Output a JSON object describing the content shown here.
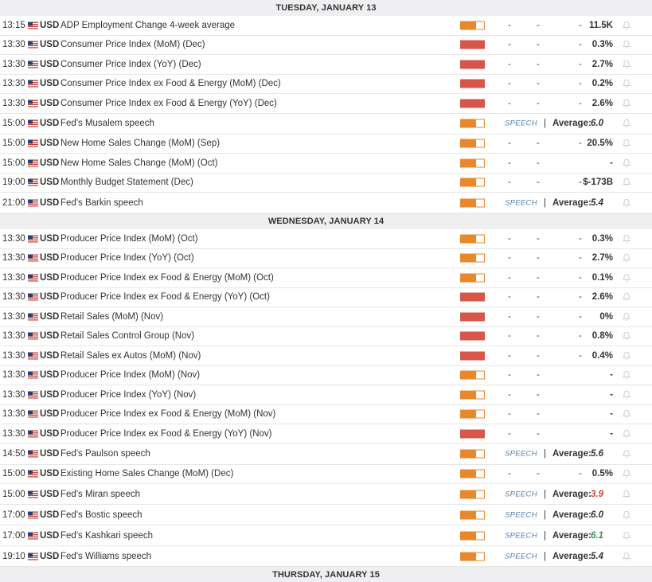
{
  "colors": {
    "medium": "#e8882a",
    "high": "#d6564a",
    "speech": "#5b7ea6",
    "negative": "#c0483a",
    "positive": "#3f8a5c"
  },
  "icons": {
    "flag": "us-flag-icon",
    "alert": "bell-icon"
  },
  "days": [
    {
      "label": "TUESDAY, JANUARY 13",
      "events": [
        {
          "time": "13:15",
          "ccy": "USD",
          "name": "ADP Employment Change 4-week average",
          "impact": "medium",
          "type": "data",
          "c1": "-",
          "c2": "-",
          "c3": "-",
          "actual": "11.5K"
        },
        {
          "time": "13:30",
          "ccy": "USD",
          "name": "Consumer Price Index (MoM) (Dec)",
          "impact": "high",
          "type": "data",
          "c1": "-",
          "c2": "-",
          "c3": "-",
          "actual": "0.3%"
        },
        {
          "time": "13:30",
          "ccy": "USD",
          "name": "Consumer Price Index (YoY) (Dec)",
          "impact": "high",
          "type": "data",
          "c1": "-",
          "c2": "-",
          "c3": "-",
          "actual": "2.7%"
        },
        {
          "time": "13:30",
          "ccy": "USD",
          "name": "Consumer Price Index ex Food & Energy (MoM) (Dec)",
          "impact": "high",
          "type": "data",
          "c1": "-",
          "c2": "-",
          "c3": "-",
          "actual": "0.2%"
        },
        {
          "time": "13:30",
          "ccy": "USD",
          "name": "Consumer Price Index ex Food & Energy (YoY) (Dec)",
          "impact": "high",
          "type": "data",
          "c1": "-",
          "c2": "-",
          "c3": "-",
          "actual": "2.6%"
        },
        {
          "time": "15:00",
          "ccy": "USD",
          "name": "Fed's Musalem speech",
          "impact": "medium",
          "type": "speech",
          "speech": "SPEECH",
          "sep": "|",
          "avg_label": "Average:",
          "avg": "6.0",
          "tone": ""
        },
        {
          "time": "15:00",
          "ccy": "USD",
          "name": "New Home Sales Change (MoM) (Sep)",
          "impact": "medium",
          "type": "data",
          "c1": "-",
          "c2": "-",
          "c3": "-",
          "actual": "20.5%"
        },
        {
          "time": "15:00",
          "ccy": "USD",
          "name": "New Home Sales Change (MoM) (Oct)",
          "impact": "medium",
          "type": "data",
          "c1": "-",
          "c2": "-",
          "c3": "-",
          "actual": "-"
        },
        {
          "time": "19:00",
          "ccy": "USD",
          "name": "Monthly Budget Statement (Dec)",
          "impact": "medium",
          "type": "data",
          "c1": "-",
          "c2": "-",
          "c3": "-",
          "actual": "$-173B"
        },
        {
          "time": "21:00",
          "ccy": "USD",
          "name": "Fed's Barkin speech",
          "impact": "medium",
          "type": "speech",
          "speech": "SPEECH",
          "sep": "|",
          "avg_label": "Average:",
          "avg": "5.4",
          "tone": ""
        }
      ]
    },
    {
      "label": "WEDNESDAY, JANUARY 14",
      "events": [
        {
          "time": "13:30",
          "ccy": "USD",
          "name": "Producer Price Index (MoM) (Oct)",
          "impact": "medium",
          "type": "data",
          "c1": "-",
          "c2": "-",
          "c3": "-",
          "actual": "0.3%"
        },
        {
          "time": "13:30",
          "ccy": "USD",
          "name": "Producer Price Index (YoY) (Oct)",
          "impact": "medium",
          "type": "data",
          "c1": "-",
          "c2": "-",
          "c3": "-",
          "actual": "2.7%"
        },
        {
          "time": "13:30",
          "ccy": "USD",
          "name": "Producer Price Index ex Food & Energy (MoM) (Oct)",
          "impact": "medium",
          "type": "data",
          "c1": "-",
          "c2": "-",
          "c3": "-",
          "actual": "0.1%"
        },
        {
          "time": "13:30",
          "ccy": "USD",
          "name": "Producer Price Index ex Food & Energy (YoY) (Oct)",
          "impact": "high",
          "type": "data",
          "c1": "-",
          "c2": "-",
          "c3": "-",
          "actual": "2.6%"
        },
        {
          "time": "13:30",
          "ccy": "USD",
          "name": "Retail Sales (MoM) (Nov)",
          "impact": "high",
          "type": "data",
          "c1": "-",
          "c2": "-",
          "c3": "-",
          "actual": "0%"
        },
        {
          "time": "13:30",
          "ccy": "USD",
          "name": "Retail Sales Control Group (Nov)",
          "impact": "high",
          "type": "data",
          "c1": "-",
          "c2": "-",
          "c3": "-",
          "actual": "0.8%"
        },
        {
          "time": "13:30",
          "ccy": "USD",
          "name": "Retail Sales ex Autos (MoM) (Nov)",
          "impact": "high",
          "type": "data",
          "c1": "-",
          "c2": "-",
          "c3": "-",
          "actual": "0.4%"
        },
        {
          "time": "13:30",
          "ccy": "USD",
          "name": "Producer Price Index (MoM) (Nov)",
          "impact": "medium",
          "type": "data",
          "c1": "-",
          "c2": "-",
          "c3": "-",
          "actual": "-"
        },
        {
          "time": "13:30",
          "ccy": "USD",
          "name": "Producer Price Index (YoY) (Nov)",
          "impact": "medium",
          "type": "data",
          "c1": "-",
          "c2": "-",
          "c3": "-",
          "actual": "-"
        },
        {
          "time": "13:30",
          "ccy": "USD",
          "name": "Producer Price Index ex Food & Energy (MoM) (Nov)",
          "impact": "medium",
          "type": "data",
          "c1": "-",
          "c2": "-",
          "c3": "-",
          "actual": "-"
        },
        {
          "time": "13:30",
          "ccy": "USD",
          "name": "Producer Price Index ex Food & Energy (YoY) (Nov)",
          "impact": "high",
          "type": "data",
          "c1": "-",
          "c2": "-",
          "c3": "-",
          "actual": "-"
        },
        {
          "time": "14:50",
          "ccy": "USD",
          "name": "Fed's Paulson speech",
          "impact": "medium",
          "type": "speech",
          "speech": "SPEECH",
          "sep": "|",
          "avg_label": "Average:",
          "avg": "5.6",
          "tone": ""
        },
        {
          "time": "15:00",
          "ccy": "USD",
          "name": "Existing Home Sales Change (MoM) (Dec)",
          "impact": "medium",
          "type": "data",
          "c1": "-",
          "c2": "-",
          "c3": "-",
          "actual": "0.5%"
        },
        {
          "time": "15:00",
          "ccy": "USD",
          "name": "Fed's Miran speech",
          "impact": "medium",
          "type": "speech",
          "speech": "SPEECH",
          "sep": "|",
          "avg_label": "Average:",
          "avg": "3.9",
          "tone": "red"
        },
        {
          "time": "17:00",
          "ccy": "USD",
          "name": "Fed's Bostic speech",
          "impact": "medium",
          "type": "speech",
          "speech": "SPEECH",
          "sep": "|",
          "avg_label": "Average:",
          "avg": "6.0",
          "tone": ""
        },
        {
          "time": "17:00",
          "ccy": "USD",
          "name": "Fed's Kashkari speech",
          "impact": "medium",
          "type": "speech",
          "speech": "SPEECH",
          "sep": "|",
          "avg_label": "Average:",
          "avg": "6.1",
          "tone": "green"
        },
        {
          "time": "19:10",
          "ccy": "USD",
          "name": "Fed's Williams speech",
          "impact": "medium",
          "type": "speech",
          "speech": "SPEECH",
          "sep": "|",
          "avg_label": "Average:",
          "avg": "5.4",
          "tone": ""
        }
      ]
    },
    {
      "label": "THURSDAY, JANUARY 15",
      "events": []
    }
  ]
}
